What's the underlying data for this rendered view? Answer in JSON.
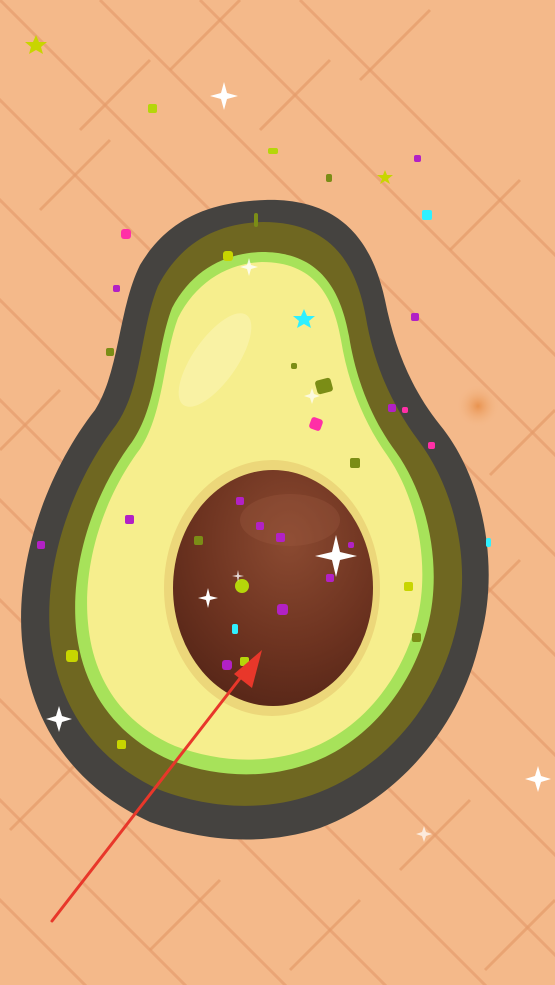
{
  "game": {
    "scene": "avocado-cut",
    "objects": [
      "wood-floor",
      "avocado",
      "avocado-pit",
      "confetti",
      "sparkles",
      "pointer-arrow"
    ]
  },
  "colors": {
    "floor": "#f4b98a",
    "floor_plank_line": "#e9a273",
    "avocado_skin": "#454340",
    "avocado_rind_dark": "#6f6721",
    "avocado_rind_light": "#a7e25a",
    "avocado_flesh": "#f6ee8d",
    "pit_rim": "#ecd77a",
    "pit": "#6d3320",
    "arrow": "#e8372a"
  },
  "confetti_colors": [
    "#ff2fa7",
    "#b221c5",
    "#b5d60a",
    "#2ff0ff",
    "#7b8d16",
    "#c8d500"
  ]
}
